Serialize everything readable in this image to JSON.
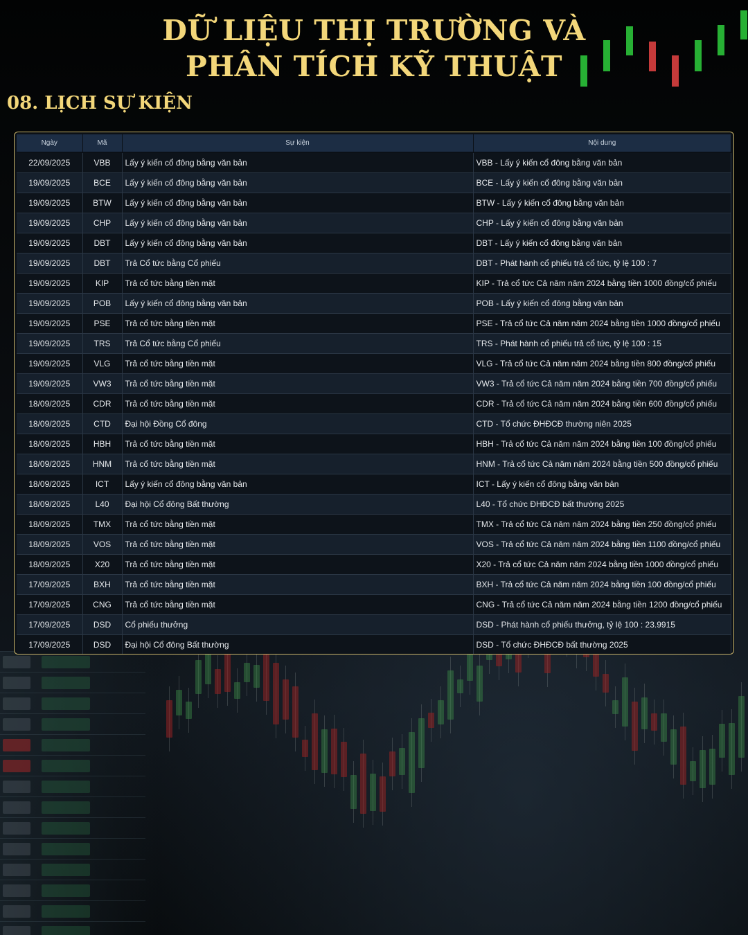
{
  "header": {
    "title_line1": "DỮ LIỆU THỊ TRƯỜNG VÀ",
    "title_line2": "PHÂN TÍCH KỸ THUẬT",
    "section_title": "08. LỊCH SỰ KIỆN"
  },
  "colors": {
    "title_gold": "#f3d77a",
    "table_border": "#c9b46a",
    "header_row_bg": "#1c2d44",
    "candle_green": "#27b034",
    "candle_red": "#c53a3a"
  },
  "table": {
    "headers": [
      "Ngày",
      "Mã",
      "Sự kiện",
      "Nội dung"
    ],
    "rows": [
      {
        "date": "22/09/2025",
        "code": "VBB",
        "event": "Lấy ý kiến cổ đông bằng văn bản",
        "content": "VBB - Lấy ý kiến cổ đông bằng văn bản"
      },
      {
        "date": "19/09/2025",
        "code": "BCE",
        "event": "Lấy ý kiến cổ đông bằng văn bản",
        "content": "BCE - Lấy ý kiến cổ đông bằng văn bản"
      },
      {
        "date": "19/09/2025",
        "code": "BTW",
        "event": "Lấy ý kiến cổ đông bằng văn bản",
        "content": "BTW - Lấy ý kiến cổ đông bằng văn bản"
      },
      {
        "date": "19/09/2025",
        "code": "CHP",
        "event": "Lấy ý kiến cổ đông bằng văn bản",
        "content": "CHP - Lấy ý kiến cổ đông bằng văn bản"
      },
      {
        "date": "19/09/2025",
        "code": "DBT",
        "event": "Lấy ý kiến cổ đông bằng văn bản",
        "content": "DBT - Lấy ý kiến cổ đông bằng văn bản"
      },
      {
        "date": "19/09/2025",
        "code": "DBT",
        "event": "Trả Cổ tức bằng Cổ phiếu",
        "content": "DBT - Phát hành cổ phiếu trả cổ tức, tỷ lệ 100 : 7"
      },
      {
        "date": "19/09/2025",
        "code": "KIP",
        "event": "Trả cổ tức bằng tiền mặt",
        "content": "KIP - Trả cổ tức Cả năm năm 2024 bằng tiền 1000 đồng/cổ phiếu"
      },
      {
        "date": "19/09/2025",
        "code": "POB",
        "event": "Lấy ý kiến cổ đông bằng văn bản",
        "content": "POB - Lấy ý kiến cổ đông bằng văn bản"
      },
      {
        "date": "19/09/2025",
        "code": "PSE",
        "event": "Trả cổ tức bằng tiền mặt",
        "content": "PSE - Trả cổ tức Cả năm năm 2024 bằng tiền 1000 đồng/cổ phiếu"
      },
      {
        "date": "19/09/2025",
        "code": "TRS",
        "event": "Trả Cổ tức bằng Cổ phiếu",
        "content": "TRS - Phát hành cổ phiếu trả cổ tức, tỷ lệ 100 : 15"
      },
      {
        "date": "19/09/2025",
        "code": "VLG",
        "event": "Trả cổ tức bằng tiền mặt",
        "content": "VLG - Trả cổ tức Cả năm năm 2024 bằng tiền 800 đồng/cổ phiếu"
      },
      {
        "date": "19/09/2025",
        "code": "VW3",
        "event": "Trả cổ tức bằng tiền mặt",
        "content": "VW3 - Trả cổ tức Cả năm năm 2024 bằng tiền 700 đồng/cổ phiếu"
      },
      {
        "date": "18/09/2025",
        "code": "CDR",
        "event": "Trả cổ tức bằng tiền mặt",
        "content": "CDR - Trả cổ tức Cả năm năm 2024 bằng tiền 600 đồng/cổ phiếu"
      },
      {
        "date": "18/09/2025",
        "code": "CTD",
        "event": "Đại hội Đồng Cổ đông",
        "content": "CTD - Tổ chức ĐHĐCĐ thường niên 2025"
      },
      {
        "date": "18/09/2025",
        "code": "HBH",
        "event": "Trả cổ tức bằng tiền mặt",
        "content": "HBH - Trả cổ tức Cả năm năm 2024 bằng tiền 100 đồng/cổ phiếu"
      },
      {
        "date": "18/09/2025",
        "code": "HNM",
        "event": "Trả cổ tức bằng tiền mặt",
        "content": "HNM - Trả cổ tức Cả năm năm 2024 bằng tiền 500 đồng/cổ phiếu"
      },
      {
        "date": "18/09/2025",
        "code": "ICT",
        "event": "Lấy ý kiến cổ đông bằng văn bản",
        "content": "ICT - Lấy ý kiến cổ đông bằng văn bản"
      },
      {
        "date": "18/09/2025",
        "code": "L40",
        "event": "Đại hội Cổ đông Bất thường",
        "content": "L40 - Tổ chức ĐHĐCĐ bất thường 2025"
      },
      {
        "date": "18/09/2025",
        "code": "TMX",
        "event": "Trả cổ tức bằng tiền mặt",
        "content": "TMX - Trả cổ tức Cả năm năm 2024 bằng tiền 250 đồng/cổ phiếu"
      },
      {
        "date": "18/09/2025",
        "code": "VOS",
        "event": "Trả cổ tức bằng tiền mặt",
        "content": "VOS - Trả cổ tức Cả năm năm 2024 bằng tiền 1100 đồng/cổ phiếu"
      },
      {
        "date": "18/09/2025",
        "code": "X20",
        "event": "Trả cổ tức bằng tiền mặt",
        "content": "X20 - Trả cổ tức Cả năm năm 2024 bằng tiền 1000 đồng/cổ phiếu"
      },
      {
        "date": "17/09/2025",
        "code": "BXH",
        "event": "Trả cổ tức bằng tiền mặt",
        "content": "BXH - Trả cổ tức Cả năm năm 2024 bằng tiền 100 đồng/cổ phiếu"
      },
      {
        "date": "17/09/2025",
        "code": "CNG",
        "event": "Trả cổ tức bằng tiền mặt",
        "content": "CNG - Trả cổ tức Cả năm năm 2024 bằng tiền 1200 đồng/cổ phiếu"
      },
      {
        "date": "17/09/2025",
        "code": "DSD",
        "event": "Cổ phiếu thưởng",
        "content": "DSD - Phát hành cổ phiếu thưởng, tỷ lệ 100 : 23.9915"
      },
      {
        "date": "17/09/2025",
        "code": "DSD",
        "event": "Đại hội Cổ đông Bất thường",
        "content": "DSD - Tổ chức ĐHĐCĐ bất thường 2025"
      }
    ]
  }
}
